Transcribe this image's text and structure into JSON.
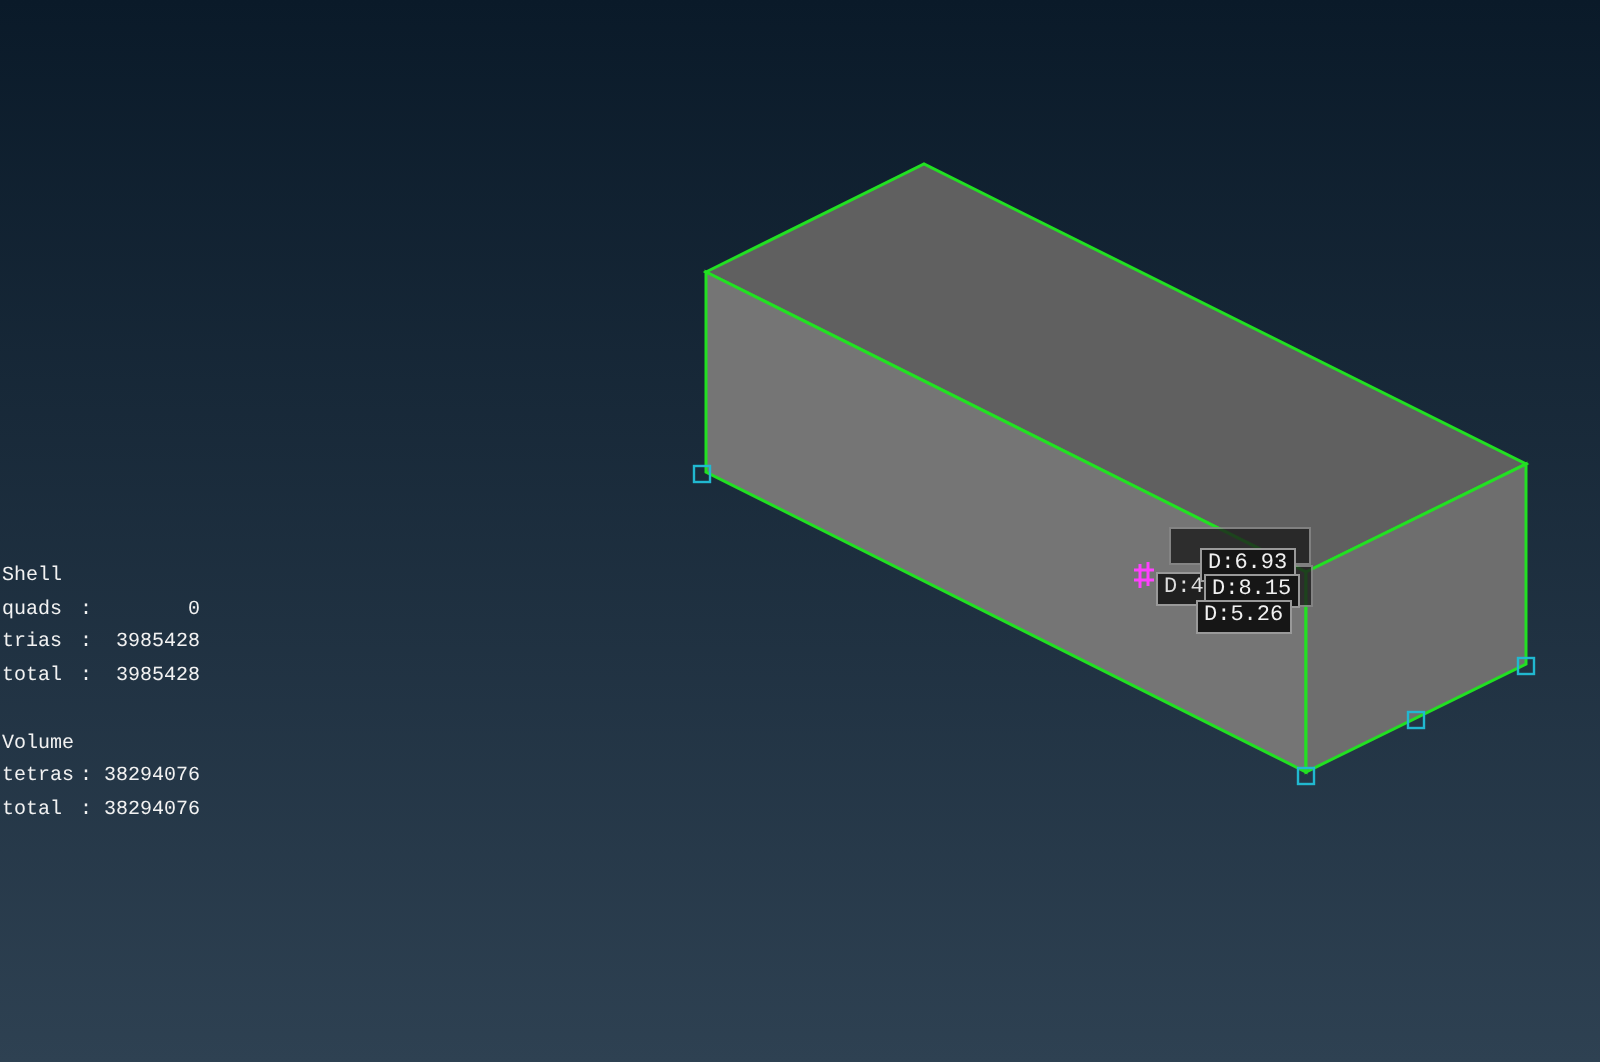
{
  "viewport": {
    "distance_labels": [
      {
        "text": "D:4",
        "front": false
      },
      {
        "text": "D:6.93",
        "front": true
      },
      {
        "text": "D:8.15",
        "front": true
      },
      {
        "text": "D:5.26",
        "front": true
      }
    ]
  },
  "statistics": {
    "sections": [
      {
        "title": "Shell",
        "rows": [
          {
            "label": "quads",
            "separator": ":",
            "value": "0"
          },
          {
            "label": "trias",
            "separator": ":",
            "value": "3985428"
          },
          {
            "label": "total",
            "separator": ":",
            "value": "3985428"
          }
        ]
      },
      {
        "title": "Volume",
        "rows": [
          {
            "label": "tetras",
            "separator": ":",
            "value": "38294076"
          },
          {
            "label": "total",
            "separator": ":",
            "value": "38294076"
          }
        ]
      }
    ]
  }
}
